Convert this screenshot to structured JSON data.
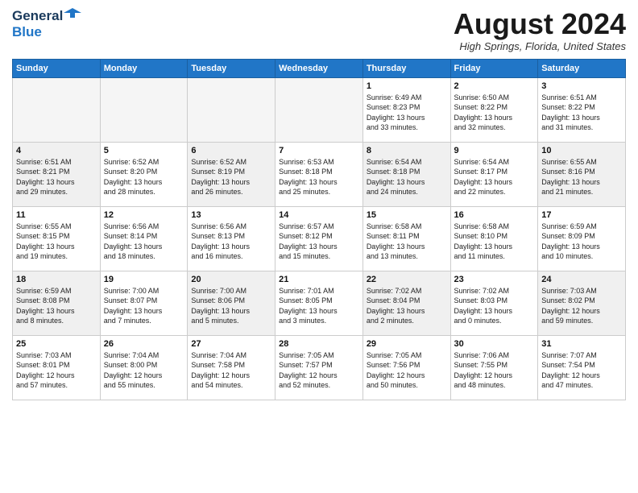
{
  "header": {
    "logo_general": "General",
    "logo_blue": "Blue",
    "month_title": "August 2024",
    "location": "High Springs, Florida, United States"
  },
  "weekdays": [
    "Sunday",
    "Monday",
    "Tuesday",
    "Wednesday",
    "Thursday",
    "Friday",
    "Saturday"
  ],
  "weeks": [
    [
      {
        "day": "",
        "info": "",
        "empty": true
      },
      {
        "day": "",
        "info": "",
        "empty": true
      },
      {
        "day": "",
        "info": "",
        "empty": true
      },
      {
        "day": "",
        "info": "",
        "empty": true
      },
      {
        "day": "1",
        "info": "Sunrise: 6:49 AM\nSunset: 8:23 PM\nDaylight: 13 hours\nand 33 minutes.",
        "empty": false
      },
      {
        "day": "2",
        "info": "Sunrise: 6:50 AM\nSunset: 8:22 PM\nDaylight: 13 hours\nand 32 minutes.",
        "empty": false
      },
      {
        "day": "3",
        "info": "Sunrise: 6:51 AM\nSunset: 8:22 PM\nDaylight: 13 hours\nand 31 minutes.",
        "empty": false
      }
    ],
    [
      {
        "day": "4",
        "info": "Sunrise: 6:51 AM\nSunset: 8:21 PM\nDaylight: 13 hours\nand 29 minutes.",
        "empty": false
      },
      {
        "day": "5",
        "info": "Sunrise: 6:52 AM\nSunset: 8:20 PM\nDaylight: 13 hours\nand 28 minutes.",
        "empty": false
      },
      {
        "day": "6",
        "info": "Sunrise: 6:52 AM\nSunset: 8:19 PM\nDaylight: 13 hours\nand 26 minutes.",
        "empty": false
      },
      {
        "day": "7",
        "info": "Sunrise: 6:53 AM\nSunset: 8:18 PM\nDaylight: 13 hours\nand 25 minutes.",
        "empty": false
      },
      {
        "day": "8",
        "info": "Sunrise: 6:54 AM\nSunset: 8:18 PM\nDaylight: 13 hours\nand 24 minutes.",
        "empty": false
      },
      {
        "day": "9",
        "info": "Sunrise: 6:54 AM\nSunset: 8:17 PM\nDaylight: 13 hours\nand 22 minutes.",
        "empty": false
      },
      {
        "day": "10",
        "info": "Sunrise: 6:55 AM\nSunset: 8:16 PM\nDaylight: 13 hours\nand 21 minutes.",
        "empty": false
      }
    ],
    [
      {
        "day": "11",
        "info": "Sunrise: 6:55 AM\nSunset: 8:15 PM\nDaylight: 13 hours\nand 19 minutes.",
        "empty": false
      },
      {
        "day": "12",
        "info": "Sunrise: 6:56 AM\nSunset: 8:14 PM\nDaylight: 13 hours\nand 18 minutes.",
        "empty": false
      },
      {
        "day": "13",
        "info": "Sunrise: 6:56 AM\nSunset: 8:13 PM\nDaylight: 13 hours\nand 16 minutes.",
        "empty": false
      },
      {
        "day": "14",
        "info": "Sunrise: 6:57 AM\nSunset: 8:12 PM\nDaylight: 13 hours\nand 15 minutes.",
        "empty": false
      },
      {
        "day": "15",
        "info": "Sunrise: 6:58 AM\nSunset: 8:11 PM\nDaylight: 13 hours\nand 13 minutes.",
        "empty": false
      },
      {
        "day": "16",
        "info": "Sunrise: 6:58 AM\nSunset: 8:10 PM\nDaylight: 13 hours\nand 11 minutes.",
        "empty": false
      },
      {
        "day": "17",
        "info": "Sunrise: 6:59 AM\nSunset: 8:09 PM\nDaylight: 13 hours\nand 10 minutes.",
        "empty": false
      }
    ],
    [
      {
        "day": "18",
        "info": "Sunrise: 6:59 AM\nSunset: 8:08 PM\nDaylight: 13 hours\nand 8 minutes.",
        "empty": false
      },
      {
        "day": "19",
        "info": "Sunrise: 7:00 AM\nSunset: 8:07 PM\nDaylight: 13 hours\nand 7 minutes.",
        "empty": false
      },
      {
        "day": "20",
        "info": "Sunrise: 7:00 AM\nSunset: 8:06 PM\nDaylight: 13 hours\nand 5 minutes.",
        "empty": false
      },
      {
        "day": "21",
        "info": "Sunrise: 7:01 AM\nSunset: 8:05 PM\nDaylight: 13 hours\nand 3 minutes.",
        "empty": false
      },
      {
        "day": "22",
        "info": "Sunrise: 7:02 AM\nSunset: 8:04 PM\nDaylight: 13 hours\nand 2 minutes.",
        "empty": false
      },
      {
        "day": "23",
        "info": "Sunrise: 7:02 AM\nSunset: 8:03 PM\nDaylight: 13 hours\nand 0 minutes.",
        "empty": false
      },
      {
        "day": "24",
        "info": "Sunrise: 7:03 AM\nSunset: 8:02 PM\nDaylight: 12 hours\nand 59 minutes.",
        "empty": false
      }
    ],
    [
      {
        "day": "25",
        "info": "Sunrise: 7:03 AM\nSunset: 8:01 PM\nDaylight: 12 hours\nand 57 minutes.",
        "empty": false
      },
      {
        "day": "26",
        "info": "Sunrise: 7:04 AM\nSunset: 8:00 PM\nDaylight: 12 hours\nand 55 minutes.",
        "empty": false
      },
      {
        "day": "27",
        "info": "Sunrise: 7:04 AM\nSunset: 7:58 PM\nDaylight: 12 hours\nand 54 minutes.",
        "empty": false
      },
      {
        "day": "28",
        "info": "Sunrise: 7:05 AM\nSunset: 7:57 PM\nDaylight: 12 hours\nand 52 minutes.",
        "empty": false
      },
      {
        "day": "29",
        "info": "Sunrise: 7:05 AM\nSunset: 7:56 PM\nDaylight: 12 hours\nand 50 minutes.",
        "empty": false
      },
      {
        "day": "30",
        "info": "Sunrise: 7:06 AM\nSunset: 7:55 PM\nDaylight: 12 hours\nand 48 minutes.",
        "empty": false
      },
      {
        "day": "31",
        "info": "Sunrise: 7:07 AM\nSunset: 7:54 PM\nDaylight: 12 hours\nand 47 minutes.",
        "empty": false
      }
    ]
  ]
}
